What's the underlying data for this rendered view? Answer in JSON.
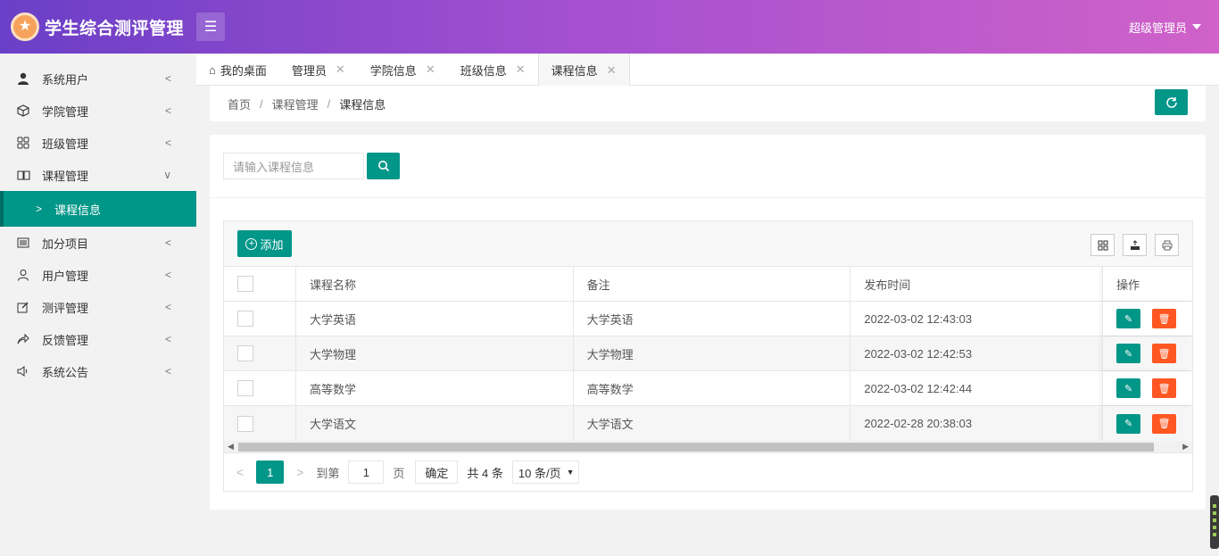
{
  "app": {
    "title": "学生综合测评管理",
    "user": "超级管理员"
  },
  "sidebar": {
    "items": [
      {
        "label": "系统用户"
      },
      {
        "label": "学院管理"
      },
      {
        "label": "班级管理"
      },
      {
        "label": "课程管理"
      },
      {
        "label": "加分项目"
      },
      {
        "label": "用户管理"
      },
      {
        "label": "测评管理"
      },
      {
        "label": "反馈管理"
      },
      {
        "label": "系统公告"
      }
    ],
    "sub": {
      "label": "课程信息"
    }
  },
  "tabs": [
    {
      "label": "我的桌面"
    },
    {
      "label": "管理员"
    },
    {
      "label": "学院信息"
    },
    {
      "label": "班级信息"
    },
    {
      "label": "课程信息"
    }
  ],
  "breadcrumb": {
    "home": "首页",
    "parent": "课程管理",
    "current": "课程信息"
  },
  "search": {
    "placeholder": "请输入课程信息"
  },
  "toolbar": {
    "add_label": "添加"
  },
  "table": {
    "headers": [
      "课程名称",
      "备注",
      "发布时间",
      "操作"
    ],
    "rows": [
      {
        "name": "大学英语",
        "note": "大学英语",
        "time": "2022-03-02 12:43:03"
      },
      {
        "name": "大学物理",
        "note": "大学物理",
        "time": "2022-03-02 12:42:53"
      },
      {
        "name": "高等数学",
        "note": "高等数学",
        "time": "2022-03-02 12:42:44"
      },
      {
        "name": "大学语文",
        "note": "大学语文",
        "time": "2022-02-28 20:38:03"
      }
    ]
  },
  "pager": {
    "current": "1",
    "goto_label": "到第",
    "page_value": "1",
    "page_unit": "页",
    "confirm": "确定",
    "total": "共 4 条",
    "page_size": "10 条/页"
  },
  "colors": {
    "primary": "#009688",
    "danger": "#ff5722",
    "header_start": "#6a3fc7",
    "header_end": "#d062c9"
  }
}
